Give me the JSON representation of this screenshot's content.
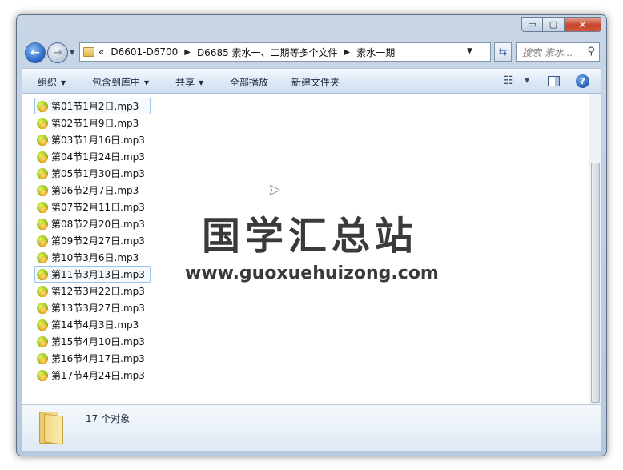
{
  "window": {
    "minimize_glyph": "▭",
    "maximize_glyph": "▢",
    "close_glyph": "✕"
  },
  "address": {
    "overflow": "«",
    "crumbs": [
      "D6601-D6700",
      "D6685 素水一、二期等多个文件",
      "素水一期"
    ],
    "search_placeholder": "搜索 素水..."
  },
  "toolbar": {
    "organize": "组织",
    "include_in_library": "包含到库中",
    "share": "共享",
    "play_all": "全部播放",
    "new_folder": "新建文件夹"
  },
  "files": [
    "第01节1月2日.mp3",
    "第02节1月9日.mp3",
    "第03节1月16日.mp3",
    "第04节1月24日.mp3",
    "第05节1月30日.mp3",
    "第06节2月7日.mp3",
    "第07节2月11日.mp3",
    "第08节2月20日.mp3",
    "第09节2月27日.mp3",
    "第10节3月6日.mp3",
    "第11节3月13日.mp3",
    "第12节3月22日.mp3",
    "第13节3月27日.mp3",
    "第14节4月3日.mp3",
    "第15节4月10日.mp3",
    "第16节4月17日.mp3",
    "第17节4月24日.mp3"
  ],
  "focused_rows": [
    0,
    10
  ],
  "watermark": {
    "title": "国学汇总站",
    "url": "www.guoxuehuizong.com"
  },
  "details": {
    "item_count": "17 个对象"
  },
  "icons": {
    "file": "mp3-audio-icon",
    "folder": "folder-icon",
    "search": "search-icon",
    "help": "help-icon"
  }
}
